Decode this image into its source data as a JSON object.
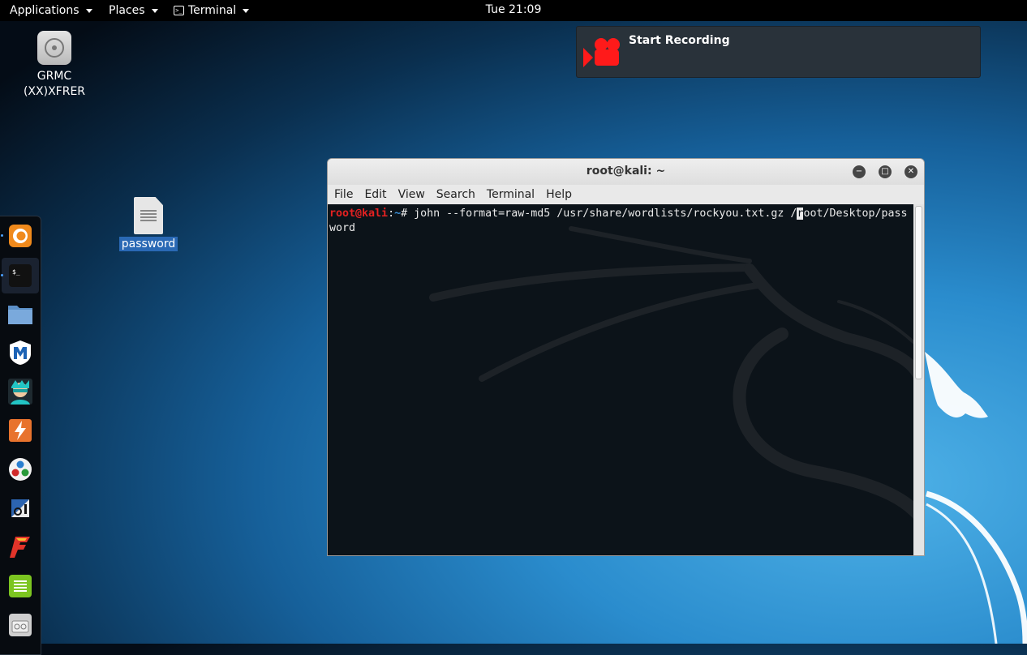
{
  "topbar": {
    "applications_label": "Applications",
    "places_label": "Places",
    "terminal_label": "Terminal",
    "clock": "Tue 21:09"
  },
  "desktop": {
    "drive_icon_label_line1": "GRMC",
    "drive_icon_label_line2": "(XX)XFRER",
    "file_icon_label": "password"
  },
  "notification": {
    "title": "Start Recording",
    "icon": "video-camera-icon",
    "accent": "#ff1a1a"
  },
  "dock": {
    "items": [
      "firefox-icon",
      "terminal-icon",
      "files-icon",
      "metasploit-icon",
      "armitage-icon",
      "burpsuite-icon",
      "maltego-icon",
      "beef-icon",
      "faraday-icon",
      "leafpad-icon",
      "settings-icon"
    ]
  },
  "terminal": {
    "title": "root@kali: ~",
    "menu": [
      "File",
      "Edit",
      "View",
      "Search",
      "Terminal",
      "Help"
    ],
    "prompt_user": "root@kali",
    "prompt_sep": ":",
    "prompt_path": "~",
    "prompt_symbol": "# ",
    "command_before_cursor": "john --format=raw-md5 /usr/share/wordlists/rockyou.txt.gz /",
    "cursor_char": "r",
    "command_after_cursor": "oot/Desktop/password"
  }
}
